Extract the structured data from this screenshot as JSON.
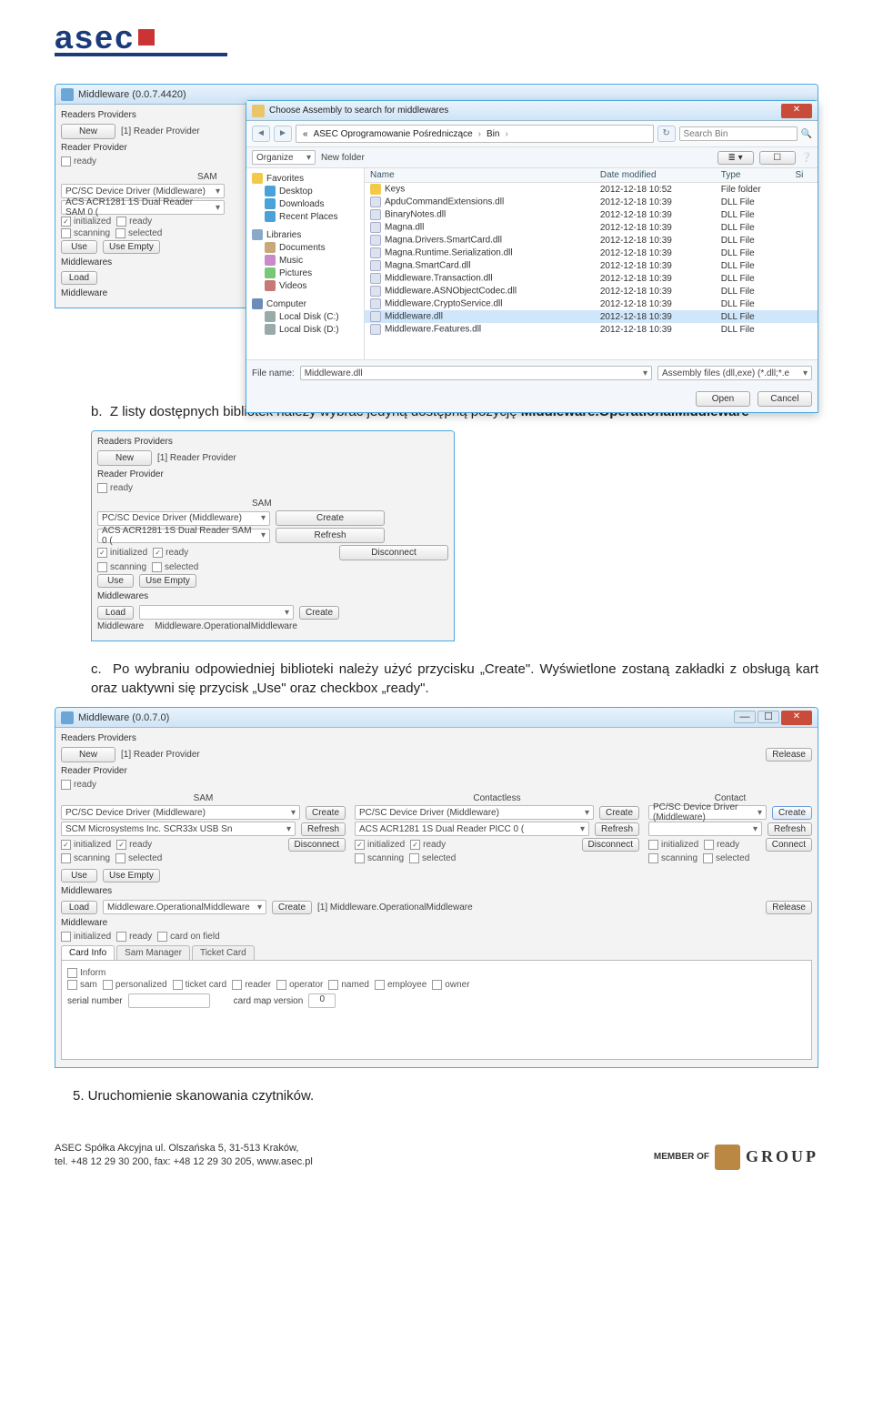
{
  "logo": {
    "text": "asec"
  },
  "paragraphs": {
    "b_prefix": "b.",
    "b_text": "Z listy dostępnych bibliotek należy wybrać jedyną dostępną pozycję ",
    "b_bold": "Middleware.OperationalMiddleware",
    "c_prefix": "c.",
    "c_text": "Po wybraniu odpowiedniej biblioteki należy użyć przycisku „Create\". Wyświetlone zostaną zakładki z obsługą kart oraz uaktywni się przycisk „Use\" oraz checkbox „ready\".",
    "five": "5.   Uruchomienie skanowania czytników."
  },
  "win_common": {
    "title_4420": "Middleware (0.0.7.4420)",
    "title_070": "Middleware (0.0.7.0)",
    "readers_providers": "Readers Providers",
    "reader_provider": "Reader Provider",
    "new": "New",
    "one_reader_provider": "[1] Reader Provider",
    "ready": "ready",
    "sam": "SAM",
    "contactless": "Contactless",
    "contact": "Contact",
    "pcsc": "PC/SC Device Driver (Middleware)",
    "acs_sam": "ACS ACR1281 1S Dual Reader SAM 0 (",
    "acs_picc": "ACS ACR1281 1S Dual Reader PICC 0 (",
    "scm": "SCM Microsystems Inc. SCR33x USB Sn",
    "initialized": "initialized",
    "scanning": "scanning",
    "selected": "selected",
    "use": "Use",
    "use_empty": "Use Empty",
    "middlewares": "Middlewares",
    "middleware": "Middleware",
    "load": "Load",
    "create": "Create",
    "refresh": "Refresh",
    "disconnect": "Disconnect",
    "connect": "Connect",
    "release": "Release",
    "mw_op": "Middleware.OperationalMiddleware",
    "one_mw_op": "[1] Middleware.OperationalMiddleware",
    "card_info": "Card Info",
    "sam_manager": "Sam Manager",
    "ticket_card": "Ticket Card",
    "inform": "Inform",
    "card_on_field": "card on field",
    "sam_chk": "sam",
    "personalized": "personalized",
    "ticket_card_chk": "ticket card",
    "reader": "reader",
    "operator": "operator",
    "named": "named",
    "employee": "employee",
    "owner": "owner",
    "serial_number": "serial number",
    "card_map_version": "card map version",
    "zero": "0"
  },
  "filedlg": {
    "title": "Choose Assembly to search for middlewares",
    "crumb1": "ASEC Oprogramowanie Pośredniczące",
    "crumb2": "Bin",
    "search_placeholder": "Search Bin",
    "organize": "Organize",
    "new_folder": "New folder",
    "cols": {
      "name": "Name",
      "date": "Date modified",
      "type": "Type",
      "size": "Si"
    },
    "tree": {
      "favorites": "Favorites",
      "desktop": "Desktop",
      "downloads": "Downloads",
      "recent": "Recent Places",
      "libraries": "Libraries",
      "documents": "Documents",
      "music": "Music",
      "pictures": "Pictures",
      "videos": "Videos",
      "computer": "Computer",
      "cdrive": "Local Disk (C:)",
      "ddrive": "Local Disk (D:)"
    },
    "rows": [
      {
        "name": "Keys",
        "date": "2012-12-18 10:52",
        "type": "File folder",
        "cls": "folder"
      },
      {
        "name": "ApduCommandExtensions.dll",
        "date": "2012-12-18 10:39",
        "type": "DLL File",
        "cls": "dll"
      },
      {
        "name": "BinaryNotes.dll",
        "date": "2012-12-18 10:39",
        "type": "DLL File",
        "cls": "dll"
      },
      {
        "name": "Magna.dll",
        "date": "2012-12-18 10:39",
        "type": "DLL File",
        "cls": "dll"
      },
      {
        "name": "Magna.Drivers.SmartCard.dll",
        "date": "2012-12-18 10:39",
        "type": "DLL File",
        "cls": "dll"
      },
      {
        "name": "Magna.Runtime.Serialization.dll",
        "date": "2012-12-18 10:39",
        "type": "DLL File",
        "cls": "dll"
      },
      {
        "name": "Magna.SmartCard.dll",
        "date": "2012-12-18 10:39",
        "type": "DLL File",
        "cls": "dll"
      },
      {
        "name": "Middleware.Transaction.dll",
        "date": "2012-12-18 10:39",
        "type": "DLL File",
        "cls": "dll"
      },
      {
        "name": "Middleware.ASNObjectCodec.dll",
        "date": "2012-12-18 10:39",
        "type": "DLL File",
        "cls": "dll"
      },
      {
        "name": "Middleware.CryptoService.dll",
        "date": "2012-12-18 10:39",
        "type": "DLL File",
        "cls": "dll"
      },
      {
        "name": "Middleware.dll",
        "date": "2012-12-18 10:39",
        "type": "DLL File",
        "cls": "dll",
        "selected": true
      },
      {
        "name": "Middleware.Features.dll",
        "date": "2012-12-18 10:39",
        "type": "DLL File",
        "cls": "dll"
      }
    ],
    "filename_lbl": "File name:",
    "filename_val": "Middleware.dll",
    "filter": "Assembly files (dll,exe) (*.dll;*.e",
    "open": "Open",
    "cancel": "Cancel"
  },
  "footer": {
    "l1": "ASEC Spółka Akcyjna      ul. Olszańska 5, 31-513 Kraków,",
    "l2": "tel. +48 12 29 30 200, fax: +48 12 29 30 205, www.asec.pl",
    "member": "MEMBER OF",
    "group": "GROUP"
  }
}
